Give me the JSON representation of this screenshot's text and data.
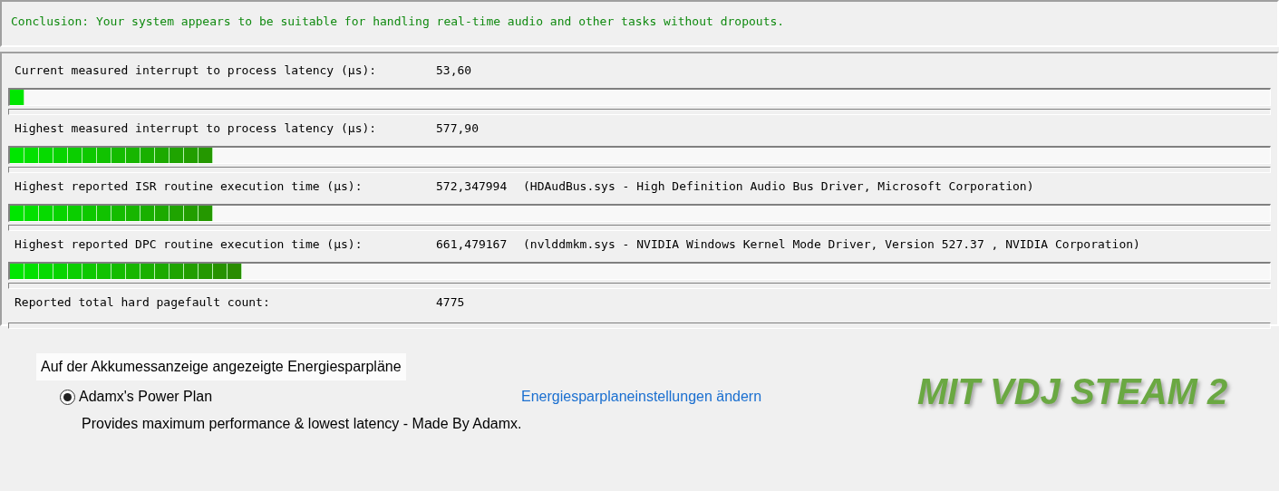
{
  "conclusion": "Conclusion: Your system appears to be suitable for handling real-time audio and other tasks without dropouts.",
  "measurements": [
    {
      "label": "Current measured interrupt to process latency (µs):",
      "value": "53,60",
      "kind": "bar"
    },
    {
      "label": "Highest measured interrupt to process latency (µs):",
      "value": "577,90",
      "kind": "bar"
    },
    {
      "label": "Highest reported ISR routine execution time (µs):",
      "value": "572,347994",
      "detail": "(HDAudBus.sys - High Definition Audio Bus Driver, Microsoft Corporation)",
      "kind": "bar"
    },
    {
      "label": "Highest reported DPC routine execution time (µs):",
      "value": "661,479167",
      "detail": "(nvlddmkm.sys - NVIDIA Windows Kernel Mode Driver, Version 527.37 , NVIDIA Corporation)",
      "kind": "bar"
    },
    {
      "label": "Reported total hard pagefault count:",
      "value": "4775",
      "kind": "count"
    }
  ],
  "power_plans": {
    "heading": "Auf der Akkumessanzeige angezeigte Energiesparpläne",
    "plans": [
      {
        "name": "Adamx's Power Plan",
        "selected": true,
        "description": "Provides maximum performance & lowest latency - Made By Adamx.",
        "link": "Energiesparplaneinstellungen ändern"
      }
    ]
  },
  "overlay_caption": "MIT VDJ STEAM 2"
}
